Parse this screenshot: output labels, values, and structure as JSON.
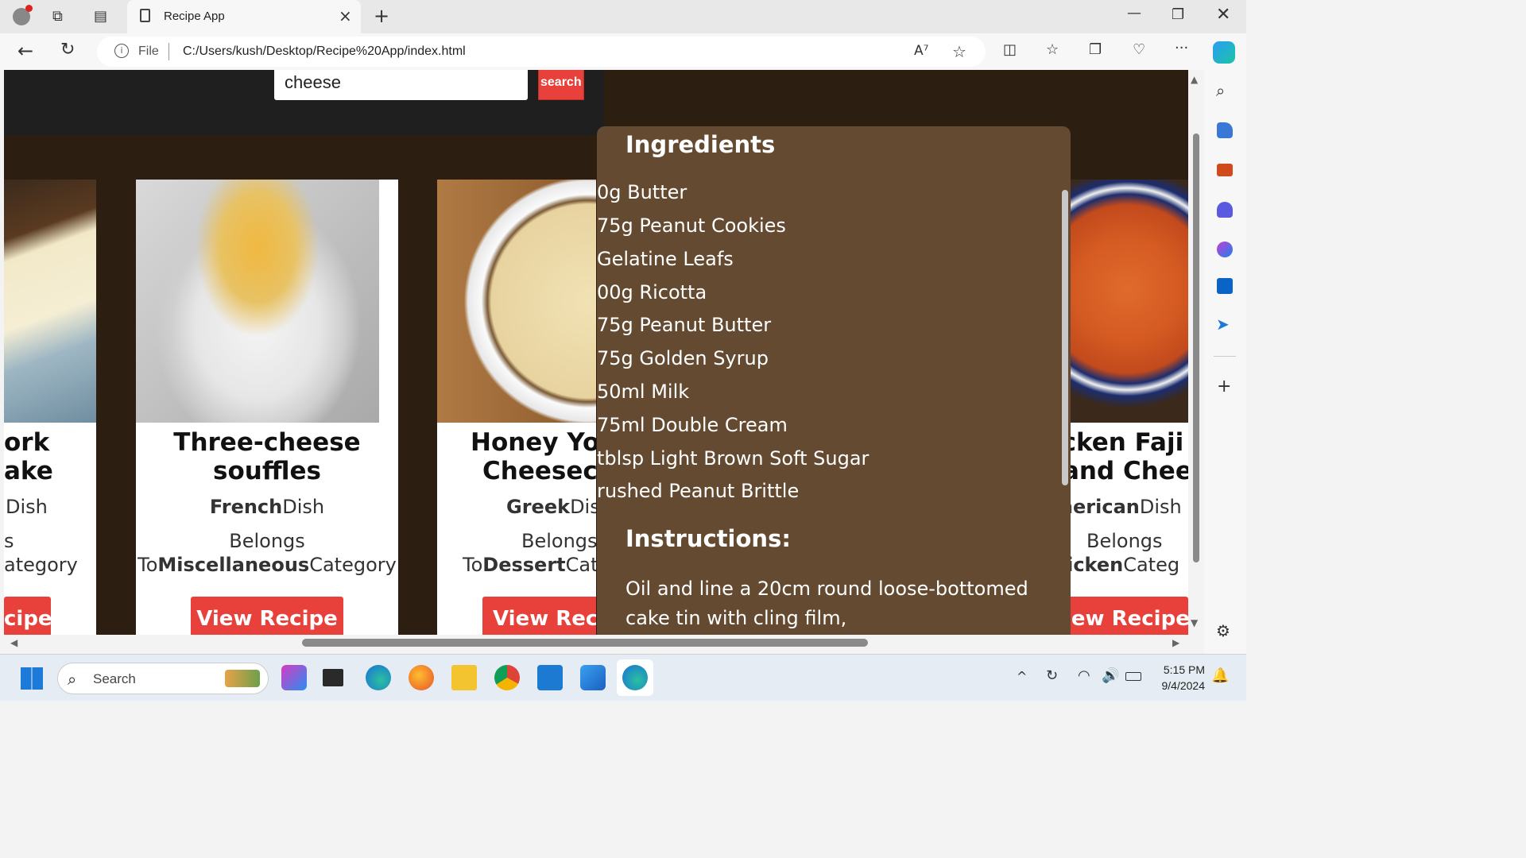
{
  "browser": {
    "tab_title": "Recipe App",
    "address_prefix": "File",
    "url": "C:/Users/kush/Desktop/Recipe%20App/index.html"
  },
  "page": {
    "search_value": "cheese",
    "search_button": "search",
    "cards": [
      {
        "name_line1": "ork",
        "name_line2": "ake",
        "area": "",
        "area_suffix": "Dish",
        "belongs_line1": "s",
        "category": "",
        "category_suffix": "ategory",
        "button": "cipe"
      },
      {
        "name_line1": "Three-cheese",
        "name_line2": "souffles",
        "area": "French",
        "area_suffix": "Dish",
        "belongs_line1": "Belongs",
        "to_prefix": "To",
        "category": "Miscellaneous",
        "category_suffix": "Category",
        "button": "View Recipe"
      },
      {
        "name_line1": "Honey Yo",
        "name_line2": "Cheeseca",
        "area": "Greek",
        "area_suffix": "Dis",
        "belongs_line1": "Belongs",
        "to_prefix": "To",
        "category": "Dessert",
        "category_suffix": "Cat",
        "button": "View Reci"
      },
      {
        "name_line1": "icken Faji",
        "name_line2": "and Chee",
        "area": "merican",
        "area_suffix": "Dish",
        "belongs_line1": "Belongs",
        "category": "hicken",
        "category_suffix": "Categ",
        "button": "iew Recipe"
      }
    ]
  },
  "modal": {
    "ingredients_title": "Ingredients",
    "ingredients": [
      "0g Butter",
      "75g Peanut Cookies",
      " Gelatine Leafs",
      "00g Ricotta",
      "75g Peanut Butter",
      "75g Golden Syrup",
      "50ml Milk",
      "75ml Double Cream",
      " tblsp Light Brown Soft Sugar",
      "rushed Peanut Brittle"
    ],
    "instructions_title": "Instructions:",
    "instructions_text": "Oil and line a 20cm round loose-bottomed cake tin with cling film,"
  },
  "taskbar": {
    "search_label": "Search",
    "time": "5:15 PM",
    "date": "9/4/2024"
  }
}
